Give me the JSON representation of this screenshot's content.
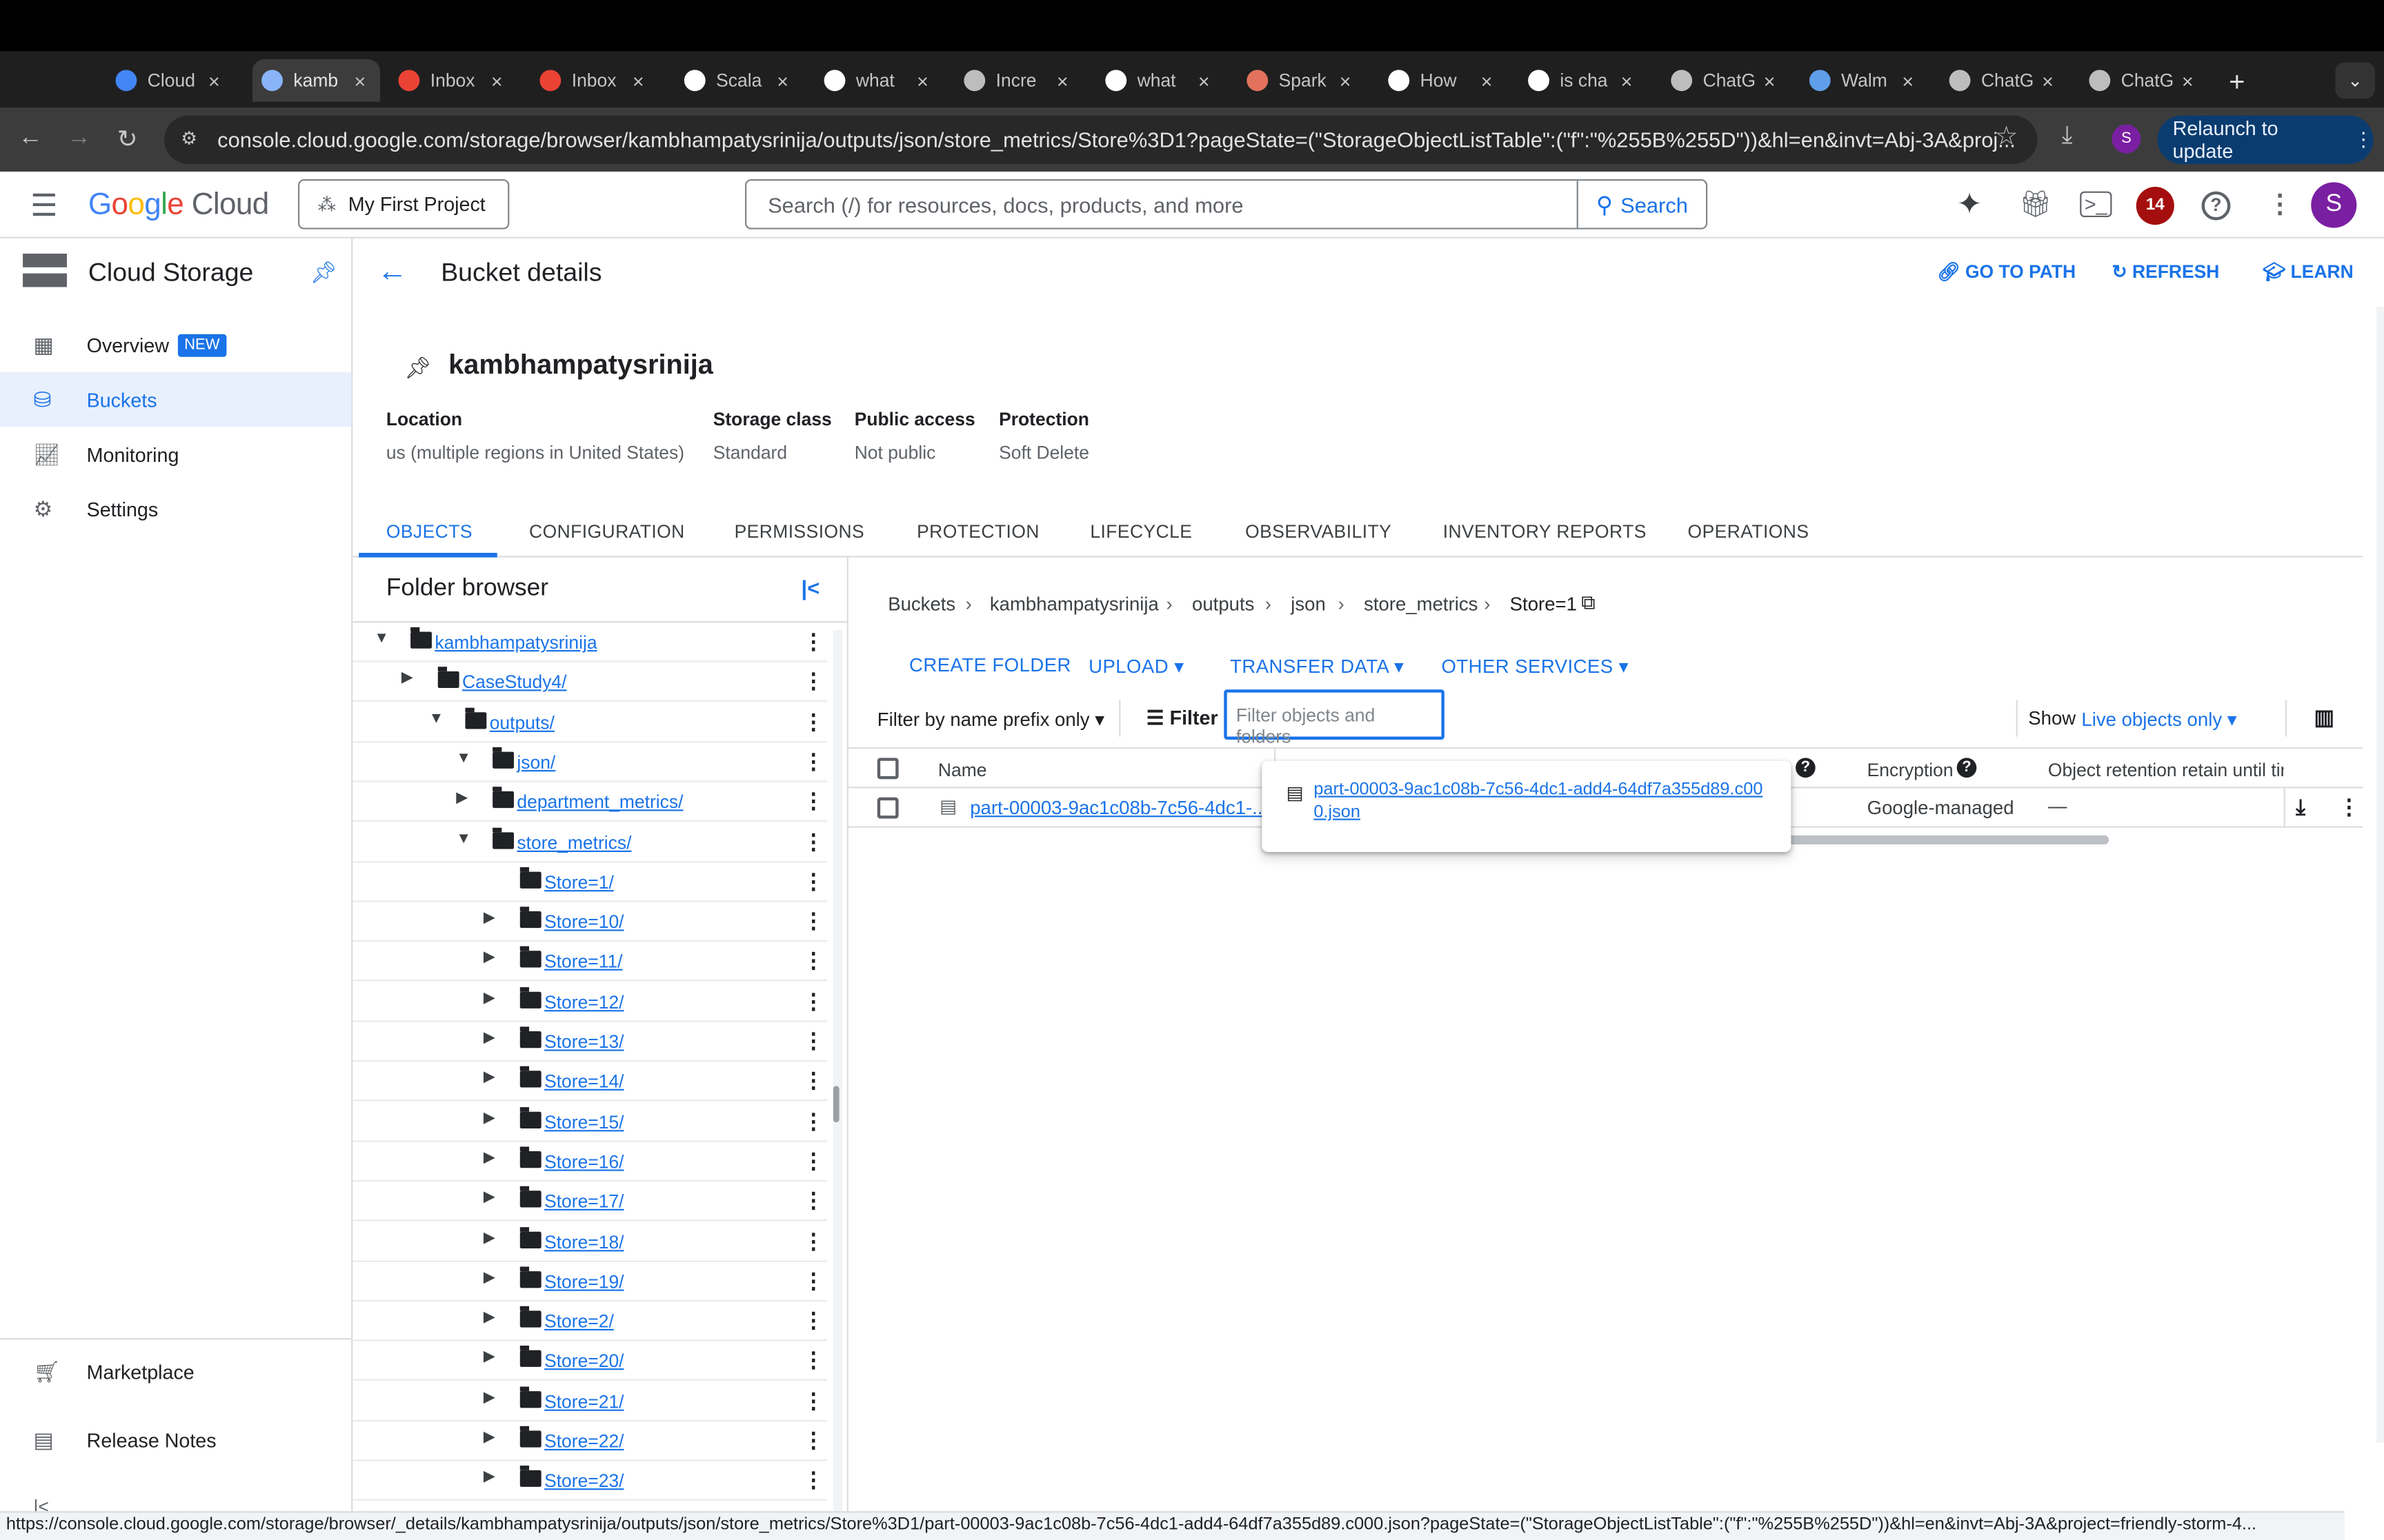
{
  "browser": {
    "tabs": [
      {
        "label": "Cloud",
        "color": "#4285f4"
      },
      {
        "label": "kamb",
        "color": "#8ab4f8"
      },
      {
        "label": "Inbox",
        "color": "#ea4335"
      },
      {
        "label": "Inbox",
        "color": "#ea4335"
      },
      {
        "label": "Scala",
        "color": "#ffffff"
      },
      {
        "label": "what",
        "color": "#ffffff"
      },
      {
        "label": "Incre",
        "color": "#bdbdbd"
      },
      {
        "label": "what",
        "color": "#ffffff"
      },
      {
        "label": "Spark",
        "color": "#e2725b"
      },
      {
        "label": "How",
        "color": "#ffffff"
      },
      {
        "label": "is cha",
        "color": "#ffffff"
      },
      {
        "label": "ChatG",
        "color": "#bdbdbd"
      },
      {
        "label": "Walm",
        "color": "#5f9ee8"
      },
      {
        "label": "ChatG",
        "color": "#bdbdbd"
      },
      {
        "label": "ChatG",
        "color": "#bdbdbd"
      }
    ],
    "close_glyph": "×",
    "new_tab": "+",
    "url": "console.cloud.google.com/storage/browser/kambhampatysrinija/outputs/json/store_metrics/Store%3D1?pageState=(\"StorageObjectListTable\":(\"f\":\"%255B%255D\"))&hl=en&invt=Abj-3A&proj...",
    "relaunch_label": "Relaunch to update",
    "profile_initial": "S",
    "status_url": "https://console.cloud.google.com/storage/browser/_details/kambhampatysrinija/outputs/json/store_metrics/Store%3D1/part-00003-9ac1c08b-7c56-4dc1-add4-64df7a355d89.c000.json?pageState=(\"StorageObjectListTable\":(\"f\":\"%255B%255D\"))&hl=en&invt=Abj-3A&project=friendly-storm-4..."
  },
  "console": {
    "logo": {
      "google": "Google",
      "cloud": "Cloud"
    },
    "project": "My First Project",
    "search_placeholder": "Search (/) for resources, docs, products, and more",
    "search_button": "Search",
    "notifications": "14",
    "avatar_initial": "S"
  },
  "nav": {
    "product": "Cloud Storage",
    "items": [
      {
        "label": "Overview",
        "badge": "NEW"
      },
      {
        "label": "Buckets"
      },
      {
        "label": "Monitoring"
      },
      {
        "label": "Settings"
      }
    ],
    "bottom": [
      {
        "label": "Marketplace"
      },
      {
        "label": "Release Notes"
      }
    ]
  },
  "page": {
    "title": "Bucket details",
    "go_to_path": "GO TO PATH",
    "refresh": "REFRESH",
    "learn": "LEARN",
    "bucket_name": "kambhampatysrinija",
    "props": [
      {
        "label": "Location",
        "value": "us (multiple regions in United States)"
      },
      {
        "label": "Storage class",
        "value": "Standard"
      },
      {
        "label": "Public access",
        "value": "Not public"
      },
      {
        "label": "Protection",
        "value": "Soft Delete"
      }
    ],
    "tabs": [
      "OBJECTS",
      "CONFIGURATION",
      "PERMISSIONS",
      "PROTECTION",
      "LIFECYCLE",
      "OBSERVABILITY",
      "INVENTORY REPORTS",
      "OPERATIONS"
    ]
  },
  "folder_browser": {
    "title": "Folder browser",
    "rows": [
      {
        "label": "kambhampatysrinija",
        "arrow": "▼",
        "kind": "bucket"
      },
      {
        "label": "CaseStudy4/",
        "arrow": "▶"
      },
      {
        "label": "outputs/",
        "arrow": "▼"
      },
      {
        "label": "json/",
        "arrow": "▼"
      },
      {
        "label": "department_metrics/",
        "arrow": "▶"
      },
      {
        "label": "store_metrics/",
        "arrow": "▼"
      },
      {
        "label": "Store=1/",
        "arrow": ""
      },
      {
        "label": "Store=10/",
        "arrow": "▶"
      },
      {
        "label": "Store=11/",
        "arrow": "▶"
      },
      {
        "label": "Store=12/",
        "arrow": "▶"
      },
      {
        "label": "Store=13/",
        "arrow": "▶"
      },
      {
        "label": "Store=14/",
        "arrow": "▶"
      },
      {
        "label": "Store=15/",
        "arrow": "▶"
      },
      {
        "label": "Store=16/",
        "arrow": "▶"
      },
      {
        "label": "Store=17/",
        "arrow": "▶"
      },
      {
        "label": "Store=18/",
        "arrow": "▶"
      },
      {
        "label": "Store=19/",
        "arrow": "▶"
      },
      {
        "label": "Store=2/",
        "arrow": "▶"
      },
      {
        "label": "Store=20/",
        "arrow": "▶"
      },
      {
        "label": "Store=21/",
        "arrow": "▶"
      },
      {
        "label": "Store=22/",
        "arrow": "▶"
      },
      {
        "label": "Store=23/",
        "arrow": "▶"
      }
    ]
  },
  "objects": {
    "breadcrumb": [
      "Buckets",
      "kambhampatysrinija",
      "outputs",
      "json",
      "store_metrics",
      "Store=1"
    ],
    "actions": [
      "CREATE FOLDER",
      "UPLOAD",
      "TRANSFER DATA",
      "OTHER SERVICES"
    ],
    "filter_mode": "Filter by name prefix only",
    "filter_label": "Filter",
    "filter_placeholder": "Filter objects and folders",
    "show_label": "Show",
    "show_value": "Live objects only",
    "columns": [
      "Name",
      "Encryption",
      "Object retention retain until time"
    ],
    "row": {
      "name": "part-00003-9ac1c08b-7c56-4dc1-...",
      "encryption": "Google-managed",
      "retention": "—"
    },
    "tooltip": "part-00003-9ac1c08b-7c56-4dc1-add4-64df7a355d89.c000.json"
  }
}
